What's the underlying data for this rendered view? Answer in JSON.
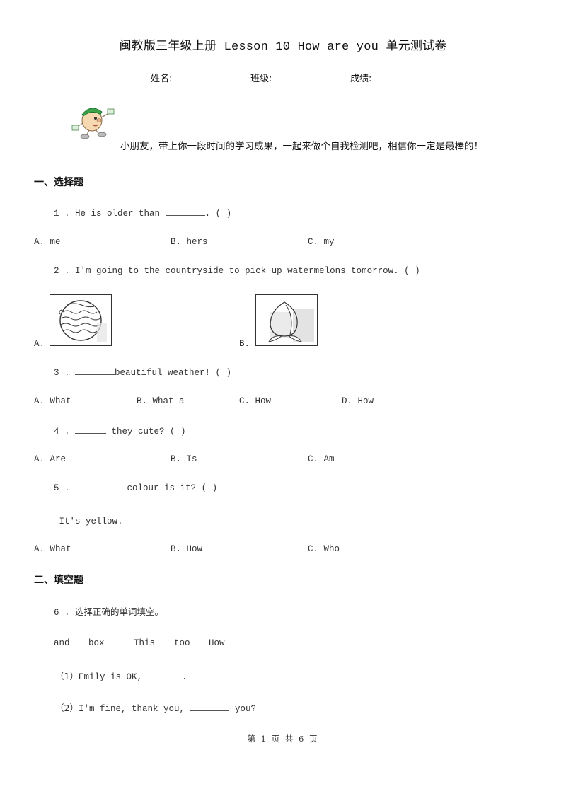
{
  "header": {
    "title_cn_prefix": "闽教版三年级上册",
    "title_en": " Lesson 10 How are you ",
    "title_cn_suffix": "单元测试卷",
    "fields": [
      {
        "label": "姓名:"
      },
      {
        "label": "班级:"
      },
      {
        "label": "成绩:"
      }
    ]
  },
  "intro": {
    "mascot_icon": "cartoon-boy-mascot",
    "text": "小朋友，带上你一段时间的学习成果，一起来做个自我检测吧，相信你一定是最棒的！"
  },
  "sections": [
    {
      "title": "一、选择题",
      "questions": [
        {
          "number": "1 .",
          "text_before": "He is older than ",
          "text_after": ".  (     )",
          "options": [
            "A. me",
            "B. hers",
            "C. my"
          ]
        },
        {
          "number": "2 .",
          "text": "I'm going to the countryside to pick up watermelons tomorrow.  (     )",
          "options": [
            {
              "label": "A.",
              "image": "watermelon-picture"
            },
            {
              "label": "B.",
              "image": "peach-picture"
            }
          ]
        },
        {
          "number": "3 .",
          "text_after": "beautiful weather!  (     )",
          "options": [
            "A. What",
            "B. What a",
            "C. How",
            "D. How"
          ]
        },
        {
          "number": "4 .",
          "text_after": " they cute?  (     )",
          "options": [
            "A. Are",
            "B. Is",
            "C. Am"
          ]
        },
        {
          "number": "5 .",
          "text_prefix": "—",
          "text_after": "colour is it?  (     )",
          "answer_line": "—It's yellow.",
          "options": [
            "A. What",
            "B. How",
            "C. Who"
          ]
        }
      ]
    },
    {
      "title": "二、填空题",
      "questions": [
        {
          "number": "6 .",
          "text": "选择正确的单词填空。",
          "word_bank": [
            "and",
            "box",
            "This",
            "too",
            "How"
          ],
          "items": [
            {
              "label": "（1）",
              "text_before": "Emily is OK,",
              "text_after": "."
            },
            {
              "label": "（2）",
              "text_before": "I'm fine, thank you, ",
              "text_after": " you?"
            }
          ]
        }
      ]
    }
  ],
  "footer": {
    "page_label": "第 1 页 共 6 页"
  }
}
